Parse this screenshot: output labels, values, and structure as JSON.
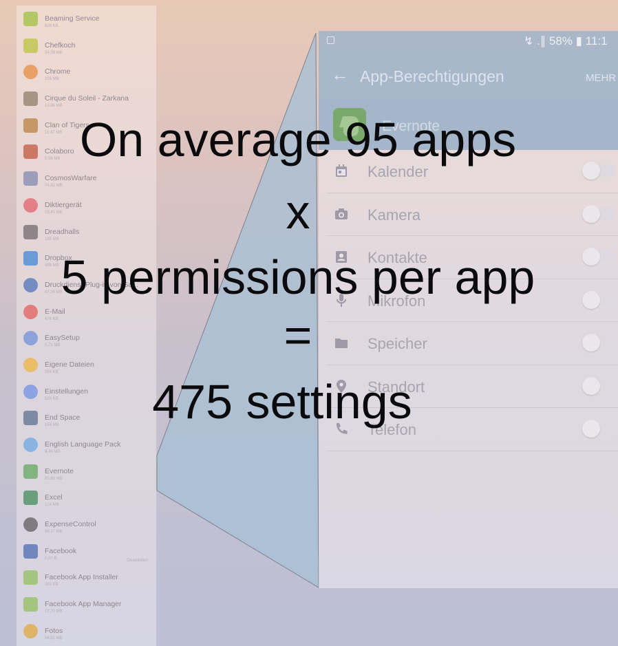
{
  "app_list": [
    {
      "name": "Beaming Service",
      "size": "828 KB",
      "color": "#9bbf3a",
      "shape": "square"
    },
    {
      "name": "Chefkoch",
      "size": "34,59 MB",
      "color": "#b9c23c",
      "shape": "square"
    },
    {
      "name": "Chrome",
      "size": "105 MB",
      "color": "#e7893c",
      "shape": "round"
    },
    {
      "name": "Cirque du Soleil - Zarkana",
      "size": "13,86 MB",
      "color": "#8a7a66",
      "shape": "square"
    },
    {
      "name": "Clan of Tigers",
      "size": "11,47 MB",
      "color": "#b8803f",
      "shape": "square"
    },
    {
      "name": "Colaboro",
      "size": "5,56 MB",
      "color": "#c0533a",
      "shape": "square"
    },
    {
      "name": "CosmosWarfare",
      "size": "74,62 MB",
      "color": "#7f86b0",
      "shape": "square"
    },
    {
      "name": "Diktiergerät",
      "size": "19,45 MB",
      "color": "#e35d6a",
      "shape": "round"
    },
    {
      "name": "Dreadhalls",
      "size": "185 MB",
      "color": "#6e6468",
      "shape": "square"
    },
    {
      "name": "Dropbox",
      "size": "598 MB",
      "color": "#3d83d6",
      "shape": "square"
    },
    {
      "name": "Druckdienst-Plug-in von Sa...",
      "size": "47,24 MB",
      "color": "#4a6fb8",
      "shape": "round"
    },
    {
      "name": "E-Mail",
      "size": "476 KB",
      "color": "#e35a59",
      "shape": "round"
    },
    {
      "name": "EasySetup",
      "size": "5,71 MB",
      "color": "#6c8fd8",
      "shape": "round"
    },
    {
      "name": "Eigene Dateien",
      "size": "264 KB",
      "color": "#f0b43a",
      "shape": "round"
    },
    {
      "name": "Einstellungen",
      "size": "528 KB",
      "color": "#6f8fe0",
      "shape": "round"
    },
    {
      "name": "End Space",
      "size": "156 MB",
      "color": "#5a6d8c",
      "shape": "square"
    },
    {
      "name": "English Language Pack",
      "size": "9,46 MB",
      "color": "#69a6e3",
      "shape": "round"
    },
    {
      "name": "Evernote",
      "size": "85,89 MB",
      "color": "#5fa85a",
      "shape": "square"
    },
    {
      "name": "Excel",
      "size": "124 MB",
      "color": "#3f8a57",
      "shape": "square"
    },
    {
      "name": "ExpenseControl",
      "size": "86,27 MB",
      "color": "#5a5a5a",
      "shape": "round"
    },
    {
      "name": "Facebook",
      "size": "0,00 B",
      "status": "Deaktiviert",
      "color": "#4a68ad",
      "shape": "square"
    },
    {
      "name": "Facebook App Installer",
      "size": "380 KB",
      "color": "#8fbf5a",
      "shape": "square"
    },
    {
      "name": "Facebook App Manager",
      "size": "17,70 MB",
      "color": "#8fbf5a",
      "shape": "square"
    },
    {
      "name": "Fotos",
      "size": "94,51 MB",
      "color": "#e0a83a",
      "shape": "round"
    }
  ],
  "phone": {
    "status_bar": {
      "text": "↯ .∥ 58% ▮ 11:1"
    },
    "app_bar": {
      "back": "←",
      "title": "App-Berechtigungen",
      "more": "MEHR"
    },
    "app_name": "Evernote",
    "permissions": [
      {
        "label": "Kalender",
        "icon": "calendar-icon",
        "enabled": false
      },
      {
        "label": "Kamera",
        "icon": "camera-icon",
        "enabled": false
      },
      {
        "label": "Kontakte",
        "icon": "contacts-icon",
        "enabled": false
      },
      {
        "label": "Mikrofon",
        "icon": "microphone-icon",
        "enabled": false
      },
      {
        "label": "Speicher",
        "icon": "folder-icon",
        "enabled": false
      },
      {
        "label": "Standort",
        "icon": "location-icon",
        "enabled": false
      },
      {
        "label": "Telefon",
        "icon": "phone-icon",
        "enabled": false
      }
    ]
  },
  "overlay": {
    "line1": "On average 95 apps",
    "line2": "x",
    "line3": "5 permissions per app",
    "line4": "=",
    "line5": "475 settings"
  }
}
